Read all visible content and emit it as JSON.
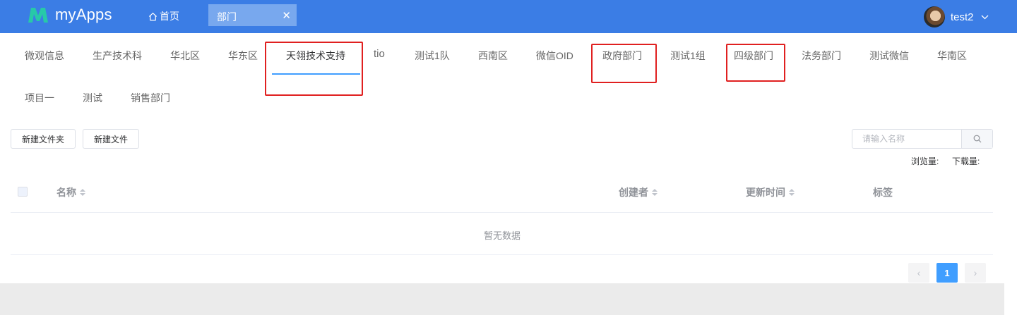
{
  "header": {
    "app_name": "myApps",
    "home_label": "首页",
    "open_tab": "部门",
    "close_glyph": "✕",
    "user_name": "test2"
  },
  "dept_tabs": [
    "微观信息",
    "生产技术科",
    "华北区",
    "华东区",
    "天翎技术支持",
    "tio",
    "测试1队",
    "西南区",
    "微信OID",
    "政府部门",
    "测试1组",
    "四级部门",
    "法务部门",
    "测试微信",
    "华南区",
    "项目一",
    "测试",
    "销售部门"
  ],
  "active_tab": "天翎技术支持",
  "toolbar": {
    "new_folder": "新建文件夹",
    "new_file": "新建文件",
    "search_placeholder": "请输入名称"
  },
  "stats": {
    "views_label": "浏览量:",
    "downloads_label": "下载量:"
  },
  "table": {
    "columns": [
      "名称",
      "创建者",
      "更新时间",
      "标签"
    ],
    "rows": [],
    "empty_text": "暂无数据"
  },
  "pagination": {
    "current_page": "1",
    "prev_glyph": "‹",
    "next_glyph": "›"
  },
  "colors": {
    "header_bg": "#3b7de5",
    "accent": "#409eff",
    "annotation_box": "#e02020"
  }
}
